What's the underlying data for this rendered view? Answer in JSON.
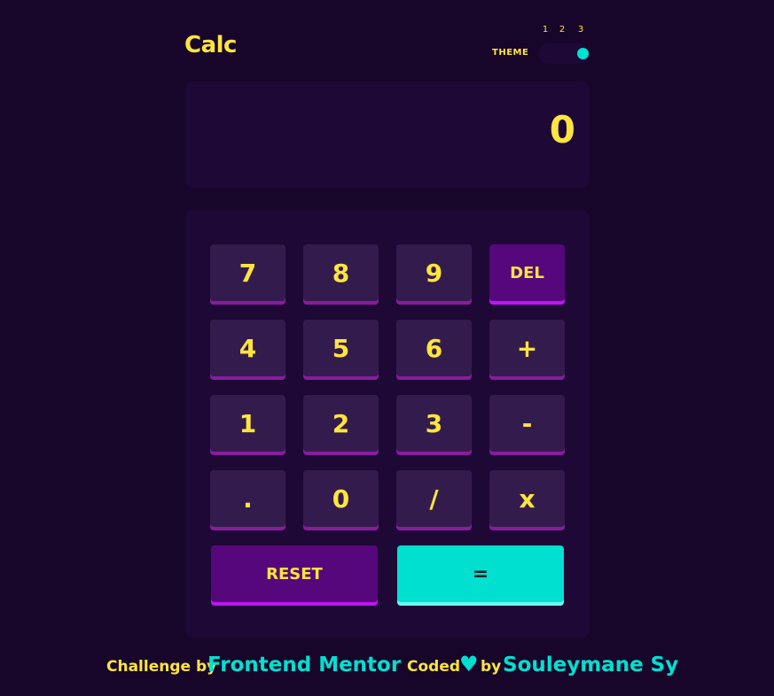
{
  "header": {
    "title": "Calc",
    "theme_label": "THEME",
    "theme_options": [
      "1",
      "2",
      "3"
    ],
    "selected_theme": 3
  },
  "screen": {
    "value": "0"
  },
  "keypad": {
    "keys": [
      {
        "label": "7",
        "name": "key-7"
      },
      {
        "label": "8",
        "name": "key-8"
      },
      {
        "label": "9",
        "name": "key-9"
      },
      {
        "label": "DEL",
        "name": "delete-button"
      },
      {
        "label": "4",
        "name": "key-4"
      },
      {
        "label": "5",
        "name": "key-5"
      },
      {
        "label": "6",
        "name": "key-6"
      },
      {
        "label": "+",
        "name": "add-button"
      },
      {
        "label": "1",
        "name": "key-1"
      },
      {
        "label": "2",
        "name": "key-2"
      },
      {
        "label": "3",
        "name": "key-3"
      },
      {
        "label": "-",
        "name": "subtract-button"
      },
      {
        "label": ".",
        "name": "decimal-button"
      },
      {
        "label": "0",
        "name": "key-0"
      },
      {
        "label": "/",
        "name": "divide-button"
      },
      {
        "label": "x",
        "name": "multiply-button"
      }
    ],
    "reset_label": "RESET",
    "equals_label": "="
  },
  "footer": {
    "challenge_prefix": "Challenge by",
    "challenge_link": "Frontend Mentor",
    "coded_prefix": "Coded",
    "heart_icon": "heart-icon",
    "by_text": "by",
    "author_link": "Souleymane Sy"
  },
  "colors": {
    "background": "#17062a",
    "panel": "#1e0836",
    "key": "#331c4d",
    "key_shadow": "#881c9e",
    "accent_purple": "#56077c",
    "accent_cyan": "#00e0d1",
    "text_yellow": "#ffe53d"
  }
}
